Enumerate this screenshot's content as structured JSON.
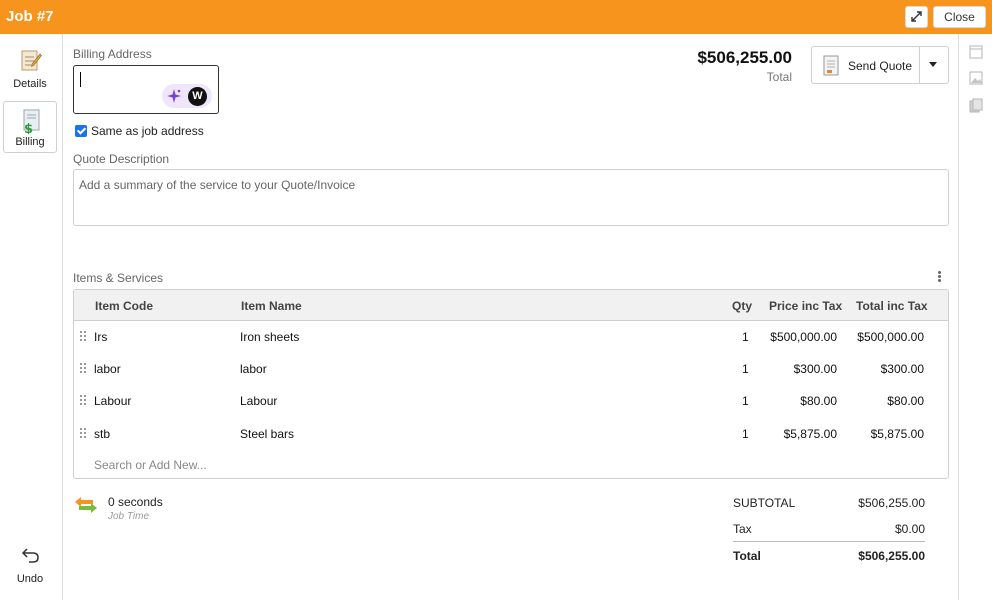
{
  "titlebar": {
    "title": "Job #7",
    "close_label": "Close"
  },
  "nav": {
    "details_label": "Details",
    "billing_label": "Billing",
    "undo_label": "Undo"
  },
  "billing": {
    "address_label": "Billing Address",
    "address_value": "",
    "same_as_job_label": "Same as job address",
    "same_as_job_checked": true
  },
  "summary": {
    "total_amount": "$506,255.00",
    "total_label": "Total"
  },
  "send_quote": {
    "label": "Send Quote"
  },
  "quote_description": {
    "label": "Quote Description",
    "placeholder": "Add a summary of the service to your Quote/Invoice"
  },
  "items": {
    "heading": "Items & Services",
    "columns": {
      "code": "Item Code",
      "name": "Item Name",
      "qty": "Qty",
      "price": "Price inc Tax",
      "total": "Total inc Tax"
    },
    "rows": [
      {
        "code": "Irs",
        "name": "Iron sheets",
        "qty": "1",
        "price": "$500,000.00",
        "total": "$500,000.00"
      },
      {
        "code": "labor",
        "name": "labor",
        "qty": "1",
        "price": "$300.00",
        "total": "$300.00"
      },
      {
        "code": "Labour",
        "name": "Labour",
        "qty": "1",
        "price": "$80.00",
        "total": "$80.00"
      },
      {
        "code": "stb",
        "name": "Steel bars",
        "qty": "1",
        "price": "$5,875.00",
        "total": "$5,875.00"
      }
    ],
    "search_placeholder": "Search or Add New..."
  },
  "job_time": {
    "value": "0 seconds",
    "label": "Job Time"
  },
  "totals": {
    "subtotal_label": "SUBTOTAL",
    "subtotal_value": "$506,255.00",
    "tax_label": "Tax",
    "tax_value": "$0.00",
    "total_label": "Total",
    "total_value": "$506,255.00"
  },
  "colors": {
    "accent": "#f7941d",
    "checkbox": "#1a73e8",
    "ai_pill": "#efe6fb"
  },
  "icons": {
    "expand": "expand-icon",
    "details": "notepad-icon",
    "billing": "dollar-document-icon",
    "undo": "undo-arrow-icon",
    "send_quote": "document-icon",
    "ai": "sparkle-icon",
    "w_badge": "w-badge-icon",
    "timer": "swap-arrows-icon",
    "more": "kebab-icon",
    "rail": [
      "window-icon",
      "image-icon",
      "copy-icon"
    ]
  }
}
